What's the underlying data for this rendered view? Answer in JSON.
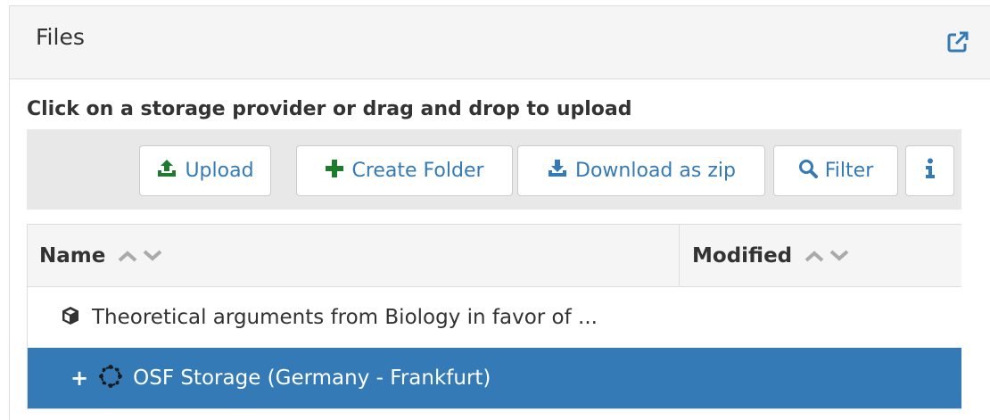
{
  "panel": {
    "title": "Files",
    "popout_icon": "external-link-icon"
  },
  "instructions": "Click on a storage provider or drag and drop to upload",
  "toolbar": {
    "upload_label": "Upload",
    "create_folder_label": "Create Folder",
    "download_zip_label": "Download as zip",
    "filter_label": "Filter",
    "info_icon": "info-icon"
  },
  "grid": {
    "columns": [
      {
        "label": "Name"
      },
      {
        "label": "Modified"
      }
    ],
    "rows": [
      {
        "icon": "cube-icon",
        "text": "Theoretical arguments from Biology in favor of ...",
        "selected": false
      },
      {
        "toggle": "+",
        "icon": "storage-icon",
        "text": "OSF Storage (Germany - Frankfurt)",
        "selected": true
      }
    ]
  },
  "colors": {
    "accent": "#337ab7",
    "create_green": "#1e7b2e",
    "header_bg": "#f5f5f5",
    "toolbar_bg": "#e8e8e8"
  }
}
